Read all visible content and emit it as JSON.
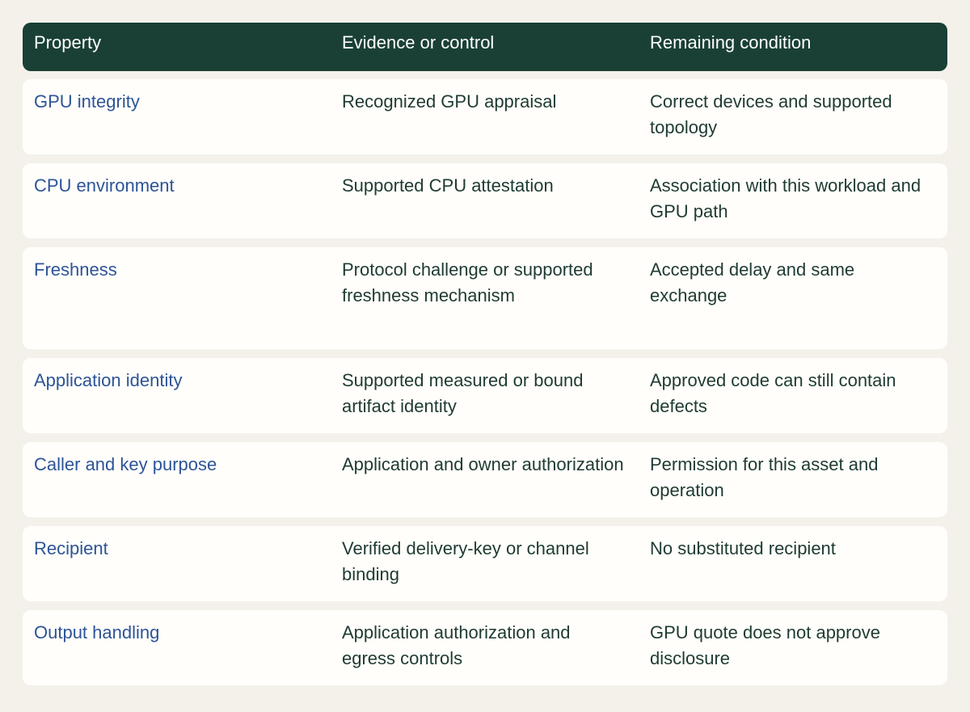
{
  "table": {
    "headers": [
      "Property",
      "Evidence or control",
      "Remaining condition"
    ],
    "rows": [
      {
        "property": "GPU integrity",
        "evidence": "Recognized GPU appraisal",
        "condition": "Correct devices and supported topology"
      },
      {
        "property": "CPU environment",
        "evidence": "Supported CPU attestation",
        "condition": "Association with this workload and GPU path"
      },
      {
        "property": "Freshness",
        "evidence": "Protocol challenge or supported freshness mechanism",
        "condition": "Accepted delay and same exchange"
      },
      {
        "property": "Application identity",
        "evidence": "Supported measured or bound artifact identity",
        "condition": "Approved code can still contain defects"
      },
      {
        "property": "Caller and key purpose",
        "evidence": "Application and owner authorization",
        "condition": "Permission for this asset and operation"
      },
      {
        "property": "Recipient",
        "evidence": "Verified delivery-key or channel binding",
        "condition": "No substituted recipient"
      },
      {
        "property": "Output handling",
        "evidence": "Application authorization and egress controls",
        "condition": "GPU quote does not approve disclosure"
      }
    ]
  }
}
